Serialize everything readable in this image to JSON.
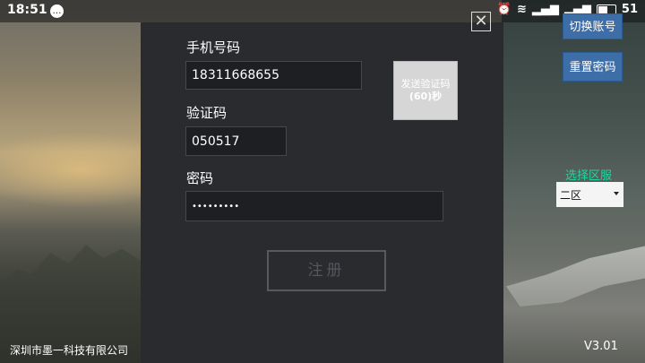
{
  "status_bar": {
    "time": "18:51",
    "battery": "51"
  },
  "form": {
    "phone_label": "手机号码",
    "phone_value": "18311668655",
    "code_label": "验证码",
    "code_value": "050517",
    "password_label": "密码",
    "password_value": "•••••••••",
    "send_code_line1": "发送验证码",
    "send_code_line2": "(60)秒",
    "register_label": "注册"
  },
  "side": {
    "switch_account": "切换账号",
    "reset_password": "重置密码",
    "select_zone_label": "选择区服",
    "zone_value": "二区"
  },
  "footer": {
    "company": "深圳市墨一科技有限公司",
    "version": "V3.01"
  }
}
